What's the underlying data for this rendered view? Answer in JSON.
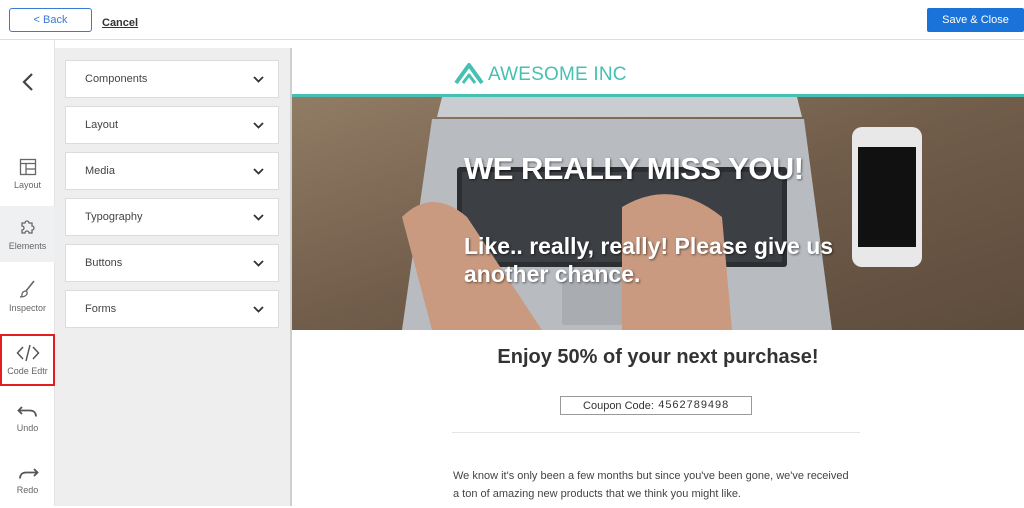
{
  "topbar": {
    "back_label": "< Back",
    "cancel_label": "Cancel",
    "save_label": "Save & Close"
  },
  "rail": {
    "collapse_icon": "chevron-left-icon",
    "items": [
      {
        "label": "Layout",
        "icon": "layout-icon"
      },
      {
        "label": "Elements",
        "icon": "puzzle-icon"
      },
      {
        "label": "Inspector",
        "icon": "brush-icon"
      },
      {
        "label": "Code Edtr",
        "icon": "code-icon"
      },
      {
        "label": "Undo",
        "icon": "undo-icon"
      },
      {
        "label": "Redo",
        "icon": "redo-icon"
      }
    ]
  },
  "panel": {
    "sections": [
      "Components",
      "Layout",
      "Media",
      "Typography",
      "Buttons",
      "Forms"
    ]
  },
  "email": {
    "brand_name": "AWESOME INC",
    "hero_title": "WE REALLY MISS YOU!",
    "hero_subtitle": "Like.. really, really! Please give us another chance.",
    "offer": "Enjoy 50% of your next purchase!",
    "coupon_label": "Coupon Code:",
    "coupon_code": "4562789498",
    "body": "We know it's only been a few months but since you've been gone, we've received a ton of amazing new products that we think you might like."
  },
  "colors": {
    "accent": "#1a73d9",
    "brand": "#45c0b2",
    "highlight": "#e0201f"
  }
}
